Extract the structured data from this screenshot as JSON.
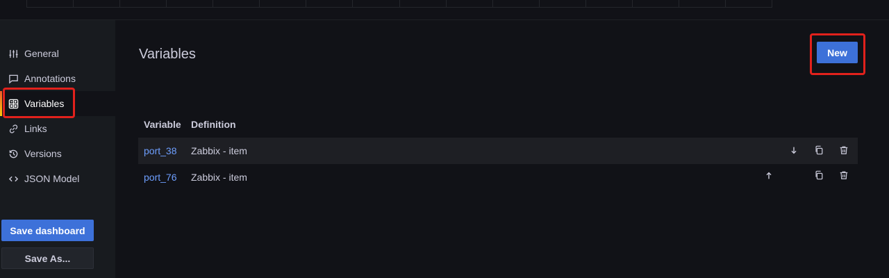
{
  "sidebar": {
    "items": [
      {
        "label": "General",
        "icon": "sliders-icon"
      },
      {
        "label": "Annotations",
        "icon": "comment-icon"
      },
      {
        "label": "Variables",
        "icon": "calculator-icon"
      },
      {
        "label": "Links",
        "icon": "link-icon"
      },
      {
        "label": "Versions",
        "icon": "history-icon"
      },
      {
        "label": "JSON Model",
        "icon": "code-icon"
      }
    ],
    "active": "Variables",
    "save_dashboard_label": "Save dashboard",
    "save_as_label": "Save As..."
  },
  "main": {
    "title": "Variables",
    "new_button_label": "New",
    "table": {
      "headers": [
        "Variable",
        "Definition"
      ],
      "rows": [
        {
          "name": "port_38",
          "definition": "Zabbix - item"
        },
        {
          "name": "port_76",
          "definition": "Zabbix - item"
        }
      ]
    }
  },
  "colors": {
    "background": "#111217",
    "sidebar": "#181b1f",
    "primary": "#3d71d9",
    "link": "#6e9fff",
    "highlight": "#e2211c"
  }
}
